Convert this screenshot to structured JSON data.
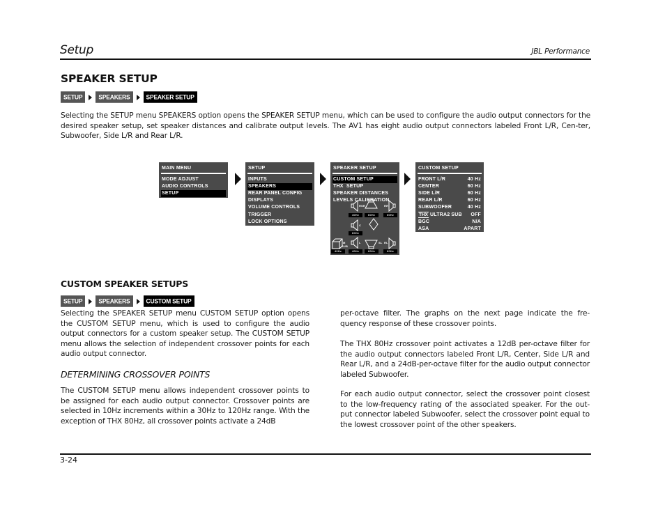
{
  "header": {
    "title": "Setup",
    "brand": "JBL Performance"
  },
  "section": {
    "title": "SPEAKER SETUP",
    "breadcrumb": [
      "SETUP",
      "SPEAKERS",
      "SPEAKER SETUP"
    ],
    "intro": "Selecting the SETUP menu SPEAKERS option opens the SPEAKER SETUP menu, which can be used to configure the audio output connectors for the desired speaker setup, set speaker distances and calibrate output levels. The AV1 has eight audio output connectors labeled Front L/R, Cen-ter, Subwoofer, Side L/R and Rear L/R."
  },
  "menus": {
    "main": {
      "title": "MAIN MENU",
      "items": [
        "MODE ADJUST",
        "AUDIO CONTROLS",
        "SETUP"
      ],
      "selected": 2
    },
    "setup": {
      "title": "SETUP",
      "items": [
        "INPUTS",
        "SPEAKERS",
        "REAR PANEL CONFIG",
        "DISPLAYS",
        "VOLUME CONTROLS",
        "TRIGGER",
        "LOCK OPTIONS"
      ],
      "selected": 1
    },
    "speaker_setup": {
      "title": "SPEAKER SETUP",
      "items": [
        "CUSTOM SETUP",
        "THX  SETUP",
        "SPEAKER DISTANCES",
        "LEVELS CALIBRATION"
      ],
      "selected": 0,
      "speakers": [
        {
          "name": "R",
          "freq": "40Hz"
        },
        {
          "name": "SR",
          "freq": "60Hz"
        },
        {
          "name": "RR",
          "freq": "60Hz"
        },
        {
          "name": "C",
          "freq": "60Hz"
        },
        {
          "name": "M SUB",
          "freq": "40Hz"
        },
        {
          "name": "L",
          "freq": "40Hz"
        },
        {
          "name": "SL",
          "freq": "60Hz"
        },
        {
          "name": "RL",
          "freq": "60Hz"
        }
      ]
    },
    "custom_setup": {
      "title": "CUSTOM SETUP",
      "rows": [
        {
          "label": "FRONT L/R",
          "value": "40 Hz"
        },
        {
          "label": "CENTER",
          "value": "60 Hz"
        },
        {
          "label": "SIDE L/R",
          "value": "60 Hz"
        },
        {
          "label": "REAR L/R",
          "value": "60 Hz"
        },
        {
          "label": "SUBWOOFER",
          "value": "40 Hz"
        },
        {
          "label": "ULTRA2 SUB",
          "value": "OFF",
          "logo": "THX"
        },
        {
          "label": "BGC",
          "value": "N/A"
        },
        {
          "label": "ASA",
          "value": "APART"
        }
      ]
    }
  },
  "custom": {
    "title": "CUSTOM SPEAKER SETUPS",
    "breadcrumb": [
      "SETUP",
      "SPEAKERS",
      "CUSTOM SETUP"
    ],
    "para1": "Selecting the SPEAKER SETUP menu CUSTOM SETUP option opens the CUSTOM SETUP menu, which is used to configure the  audio output connectors for a custom speaker setup. The CUSTOM SETUP menu allows the selection of independent crossover points for each  audio output connector.",
    "crossover_title": "DETERMINING CROSSOVER POINTS",
    "para2": "The CUSTOM SETUP menu allows independent crossover points to be assigned for each audio output connector. Crossover points are selected in 10Hz increments within a 30Hz to 120Hz range. With the exception of THX 80Hz, all crossover points activate a 24dB",
    "para3": "per-octave filter. The graphs on the next page indicate the fre-quency response of these crossover points.",
    "para4": "The THX 80Hz crossover point activates a 12dB per-octave filter for the audio output connectors labeled Front L/R, Center, Side L/R and Rear L/R, and a 24dB-per-octave filter for the audio output connector labeled Subwoofer.",
    "para5": "For each audio output connector, select the crossover point closest to the low-frequency rating of the associated speaker. For the out-put connector labeled Subwoofer, select the crossover point equal to the lowest crossover point of the other speakers."
  },
  "footer": {
    "page": "3-24"
  }
}
